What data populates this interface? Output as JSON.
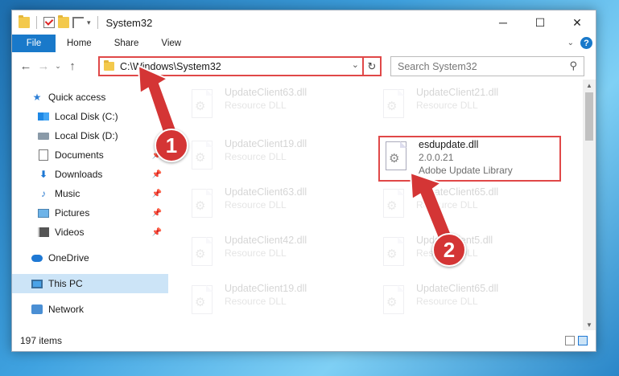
{
  "window": {
    "title": "System32",
    "controls": {
      "minimize": "─",
      "maximize": "☐",
      "close": "✕"
    }
  },
  "ribbon": {
    "file_tab": "File",
    "tabs": [
      "Home",
      "Share",
      "View"
    ]
  },
  "address": {
    "path": "C:\\Windows\\System32",
    "search_placeholder": "Search System32"
  },
  "sidebar": {
    "items": [
      {
        "label": "Quick access",
        "icon": "star-icon"
      },
      {
        "label": "Local Disk (C:)",
        "icon": "drive-icon"
      },
      {
        "label": "Local Disk (D:)",
        "icon": "drive-icon"
      },
      {
        "label": "Documents",
        "icon": "documents-icon"
      },
      {
        "label": "Downloads",
        "icon": "download-icon"
      },
      {
        "label": "Music",
        "icon": "music-icon"
      },
      {
        "label": "Pictures",
        "icon": "pictures-icon"
      },
      {
        "label": "Videos",
        "icon": "videos-icon"
      },
      {
        "label": "OneDrive",
        "icon": "cloud-icon"
      },
      {
        "label": "This PC",
        "icon": "pc-icon"
      },
      {
        "label": "Network",
        "icon": "network-icon"
      }
    ]
  },
  "files": [
    {
      "name": "UpdateClient63.dll",
      "type": "Resource DLL"
    },
    {
      "name": "UpdateClient21.dll",
      "type": "Resource DLL"
    },
    {
      "name": "UpdateClient19.dll",
      "type": "Resource DLL"
    },
    {
      "name": "UpdateClient63.dll",
      "type": "Resource DLL"
    },
    {
      "name": "UpdateClient65.dll",
      "type": "Resource DLL"
    },
    {
      "name": "UpdateClient42.dll",
      "type": "Resource DLL"
    },
    {
      "name": "UpdateClient5.dll",
      "type": "Resource DLL"
    },
    {
      "name": "UpdateClient19.dll",
      "type": "Resource DLL"
    },
    {
      "name": "UpdateClient65.dll",
      "type": "Resource DLL"
    }
  ],
  "highlighted_file": {
    "name": "esdupdate.dll",
    "version": "2.0.0.21",
    "description": "Adobe Update Library"
  },
  "status": {
    "item_count": "197 items"
  },
  "callouts": {
    "one": "1",
    "two": "2"
  },
  "colors": {
    "accent": "#1979ca",
    "highlight": "#e04848",
    "callout": "#d43535"
  }
}
